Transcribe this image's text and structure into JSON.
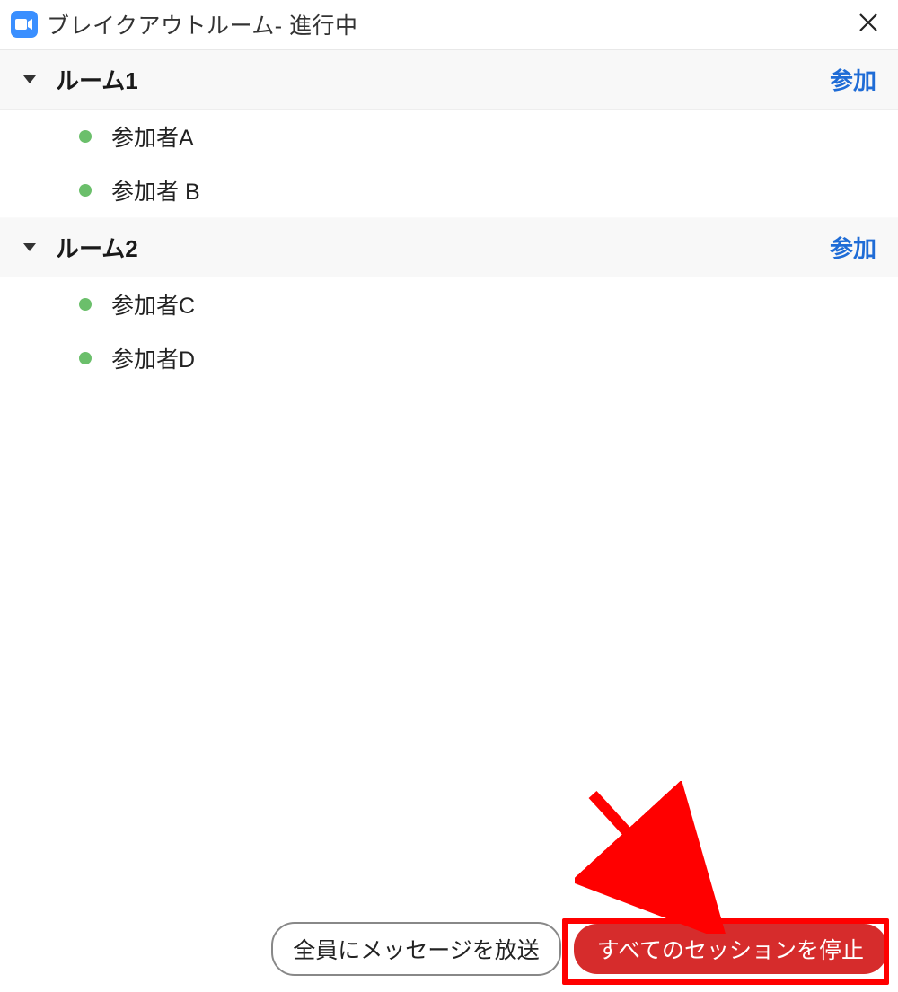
{
  "window": {
    "title": "ブレイクアウトルーム- 進行中"
  },
  "join_label": "参加",
  "rooms": [
    {
      "name": "ルーム1",
      "participants": [
        "参加者A",
        "参加者 B"
      ]
    },
    {
      "name": "ルーム2",
      "participants": [
        "参加者C",
        "参加者D"
      ]
    }
  ],
  "footer": {
    "broadcast_label": "全員にメッセージを放送",
    "stop_label": "すべてのセッションを停止"
  }
}
